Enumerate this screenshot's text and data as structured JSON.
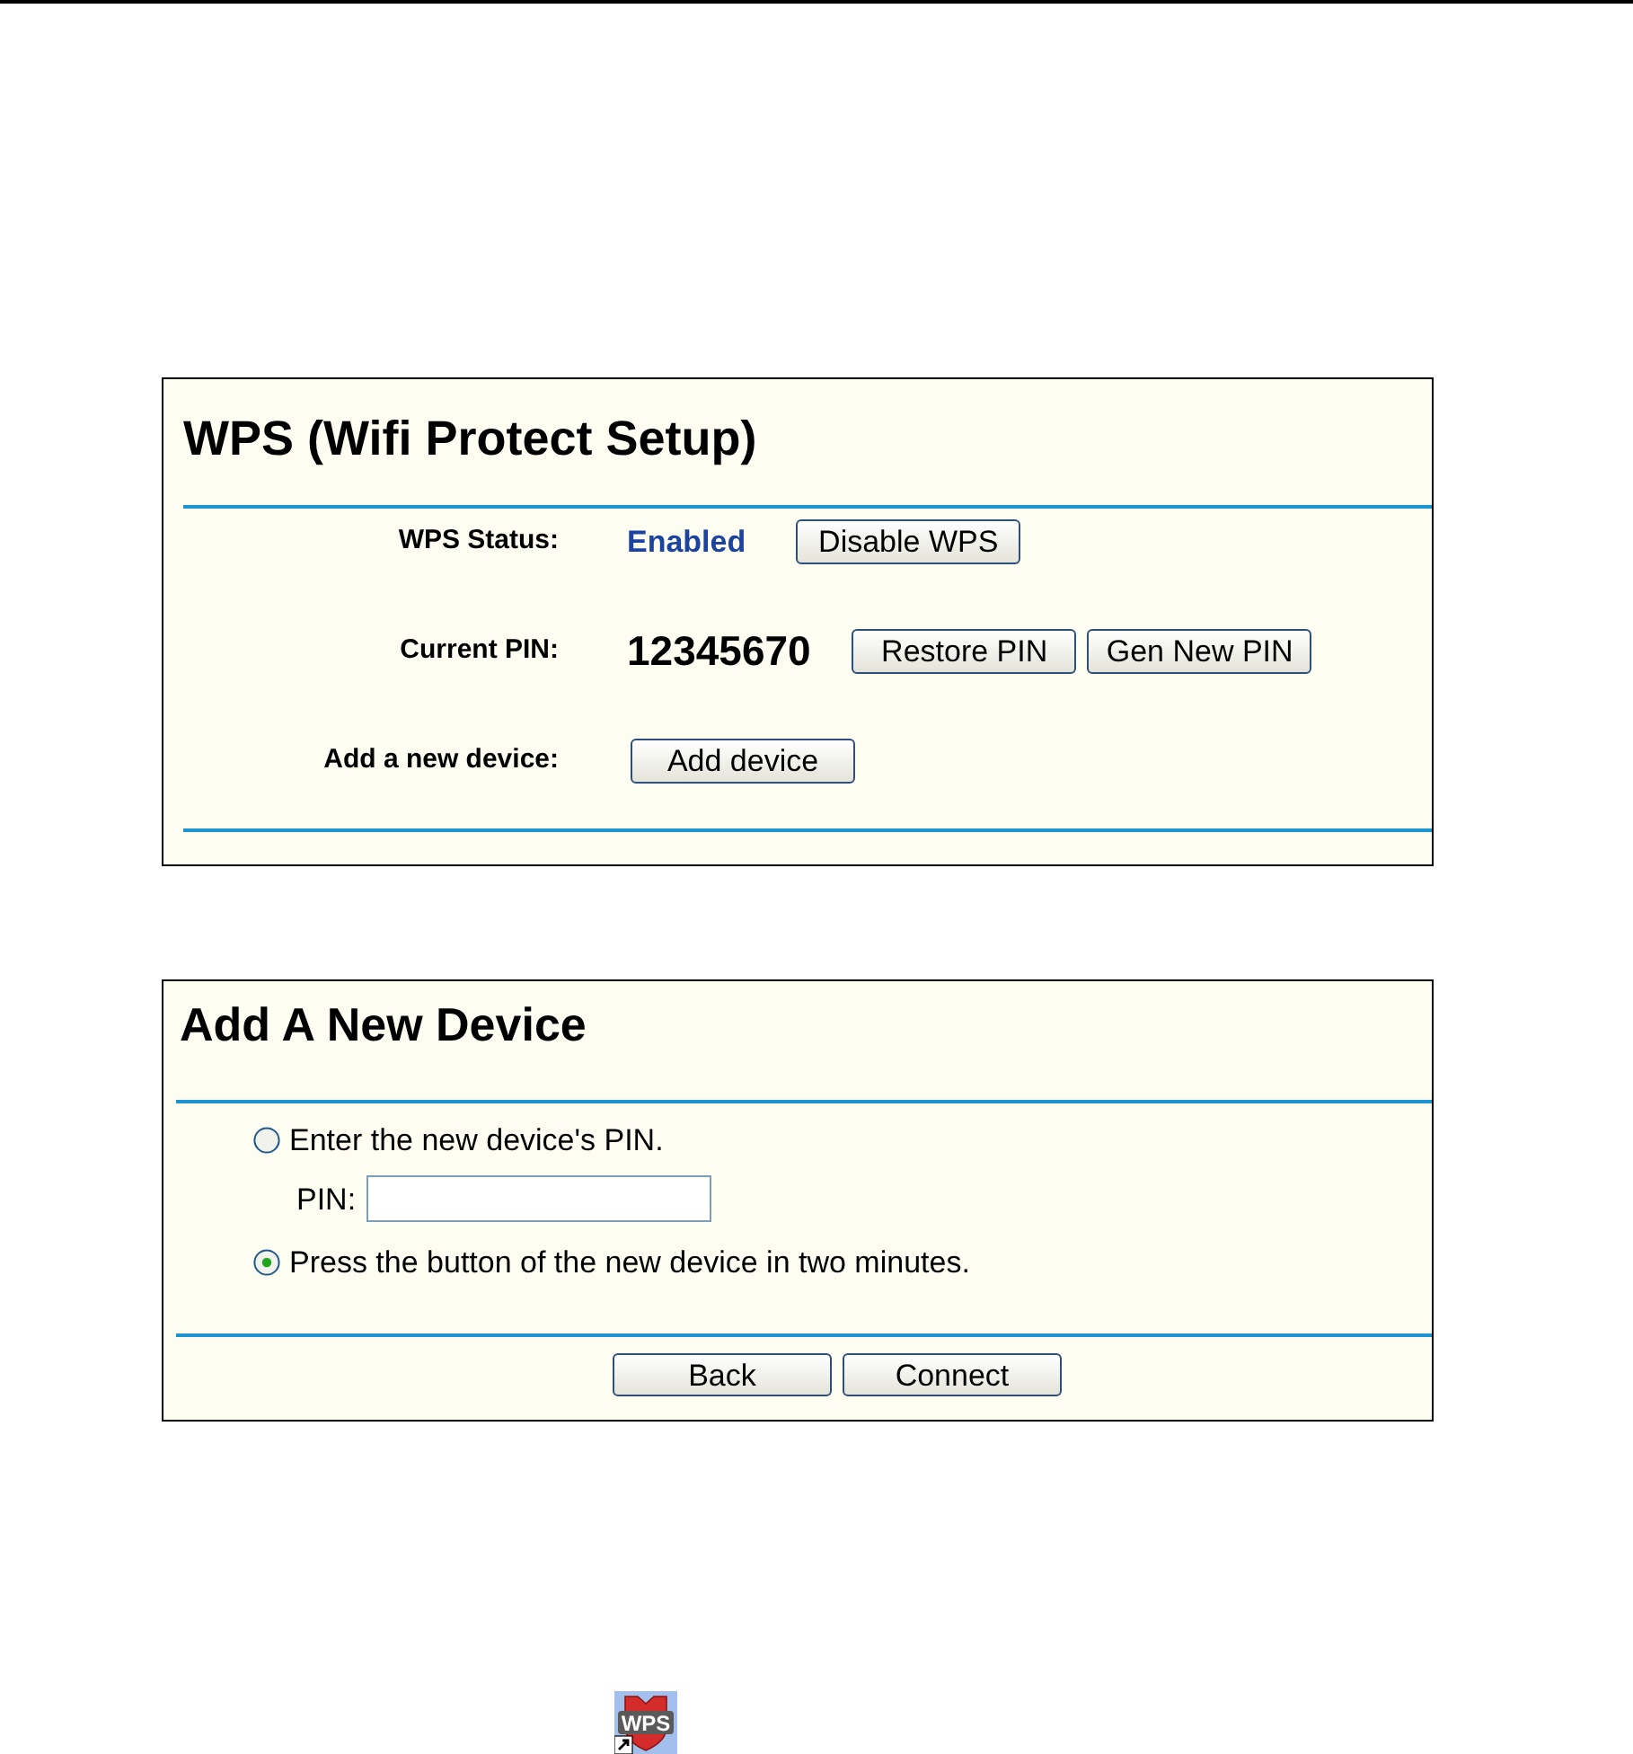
{
  "wps_panel": {
    "title": "WPS (Wifi Protect Setup)",
    "rows": [
      {
        "kind": "status",
        "label": "WPS Status:",
        "value": "Enabled",
        "buttons": [
          "Disable WPS"
        ]
      },
      {
        "kind": "pin",
        "label": "Current PIN:",
        "value": "12345670",
        "buttons": [
          "Restore PIN",
          "Gen New PIN"
        ]
      },
      {
        "kind": "action",
        "label": "Add a new device:",
        "buttons": [
          "Add device"
        ]
      }
    ]
  },
  "add_device_panel": {
    "title": "Add A New Device",
    "options": [
      {
        "label": "Enter the new device's PIN.",
        "selected": false,
        "pin_field": {
          "label": "PIN:"
        }
      },
      {
        "label": "Press the button of the new device in two minutes.",
        "selected": true
      }
    ],
    "buttons": [
      "Back",
      "Connect"
    ]
  },
  "shortcut_icon": {
    "label": "WPS"
  }
}
